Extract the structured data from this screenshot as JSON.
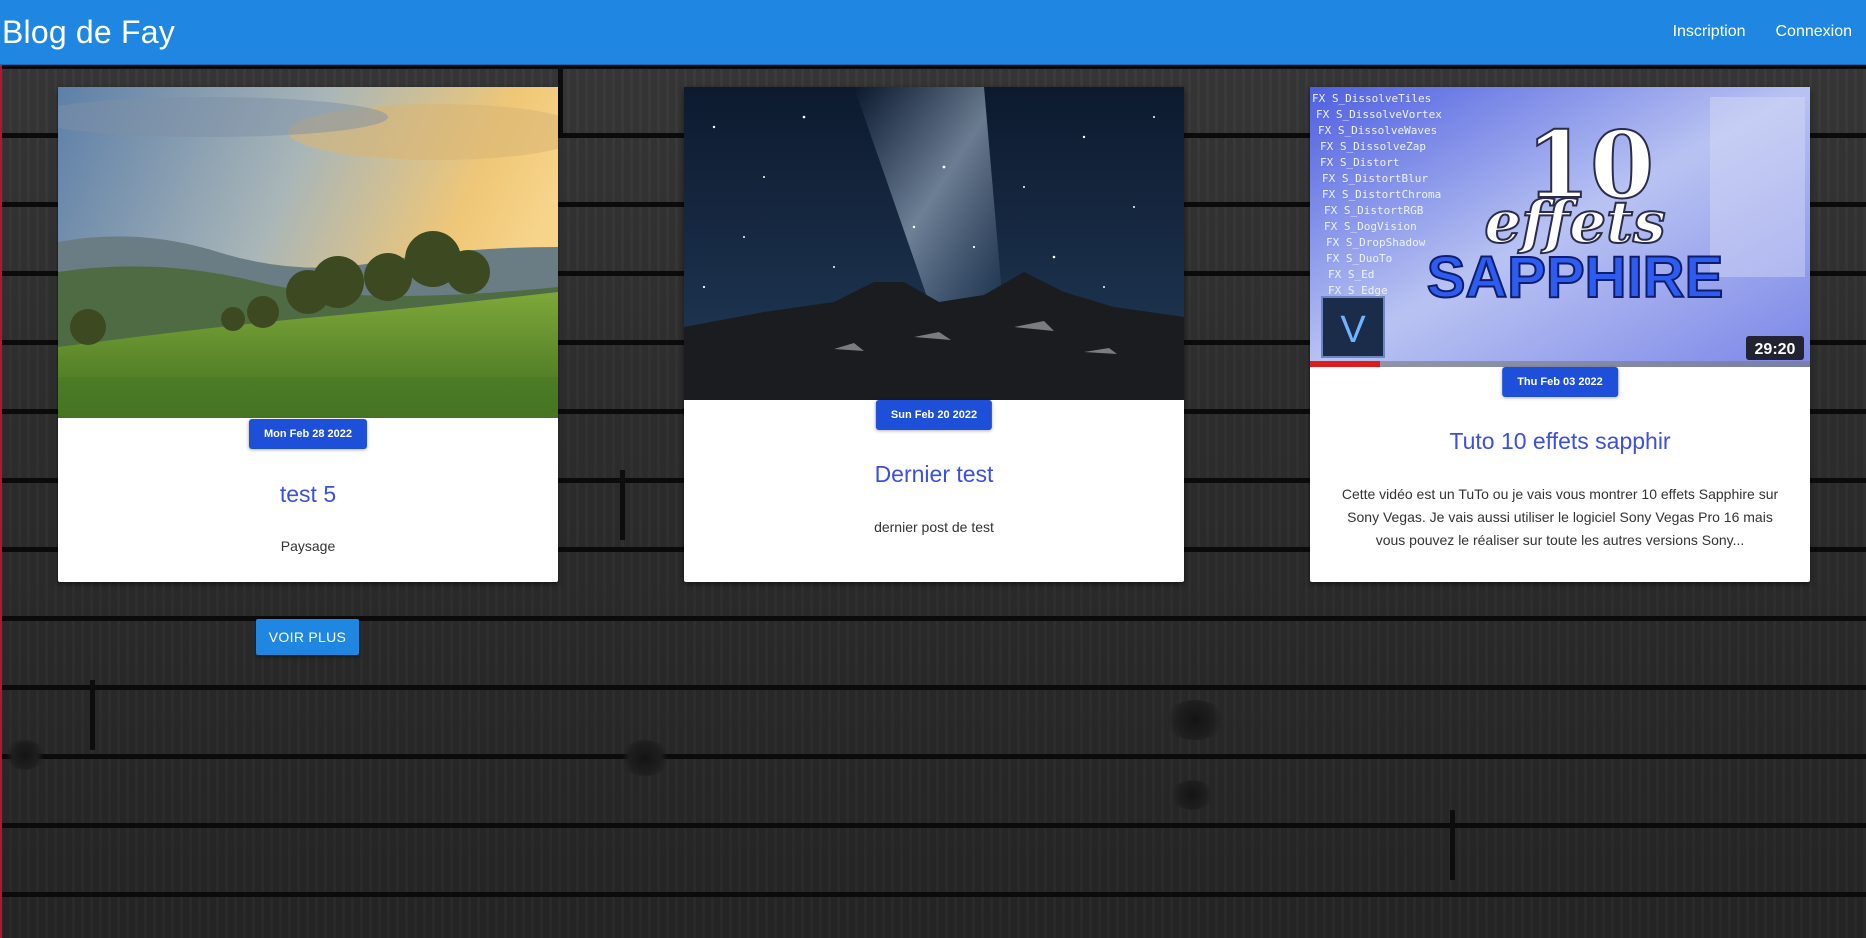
{
  "navbar": {
    "brand": "Blog de Fay",
    "links": [
      "Inscription",
      "Connexion"
    ]
  },
  "posts": [
    {
      "date": "Mon Feb 28 2022",
      "title": "test 5",
      "description": "Paysage",
      "image": "landscape-hills-trees"
    },
    {
      "date": "Sun Feb 20 2022",
      "title": "Dernier test",
      "description": "dernier post de test",
      "image": "milky-way-mountain"
    },
    {
      "date": "Thu Feb 03 2022",
      "title": "Tuto 10 effets sapphir",
      "description": "Cette vidéo est un TuTo ou je vais vous montrer 10 effets Sapphire sur Sony Vegas. Je vais aussi utiliser le logiciel Sony Vegas Pro 16 mais vous pouvez le réaliser sur toute les autres versions Sony...",
      "image": "video-thumbnail",
      "thumbnail": {
        "headline_number": "10",
        "headline_word": "effets",
        "headline_brand": "SAPPHIRE",
        "logo_letter": "V",
        "duration": "29:20",
        "effect_list": [
          "FX S_DissolveTiles",
          "FX S_DissolveVortex",
          "FX S_DissolveWaves",
          "FX S_DissolveZap",
          "FX S_Distort",
          "FX S_DistortBlur",
          "FX S_DistortChroma",
          "FX S_DistortRGB",
          "FX S_DogVision",
          "FX S_DropShadow",
          "FX S_DuoTo",
          "FX S_Ed",
          "FX S_Edge"
        ]
      }
    }
  ],
  "load_more_label": "VOIR PLUS",
  "colors": {
    "navbar": "#1f86e2",
    "badge": "#1d4fd8",
    "title": "#3b4ee6",
    "button": "#1f86e2"
  }
}
